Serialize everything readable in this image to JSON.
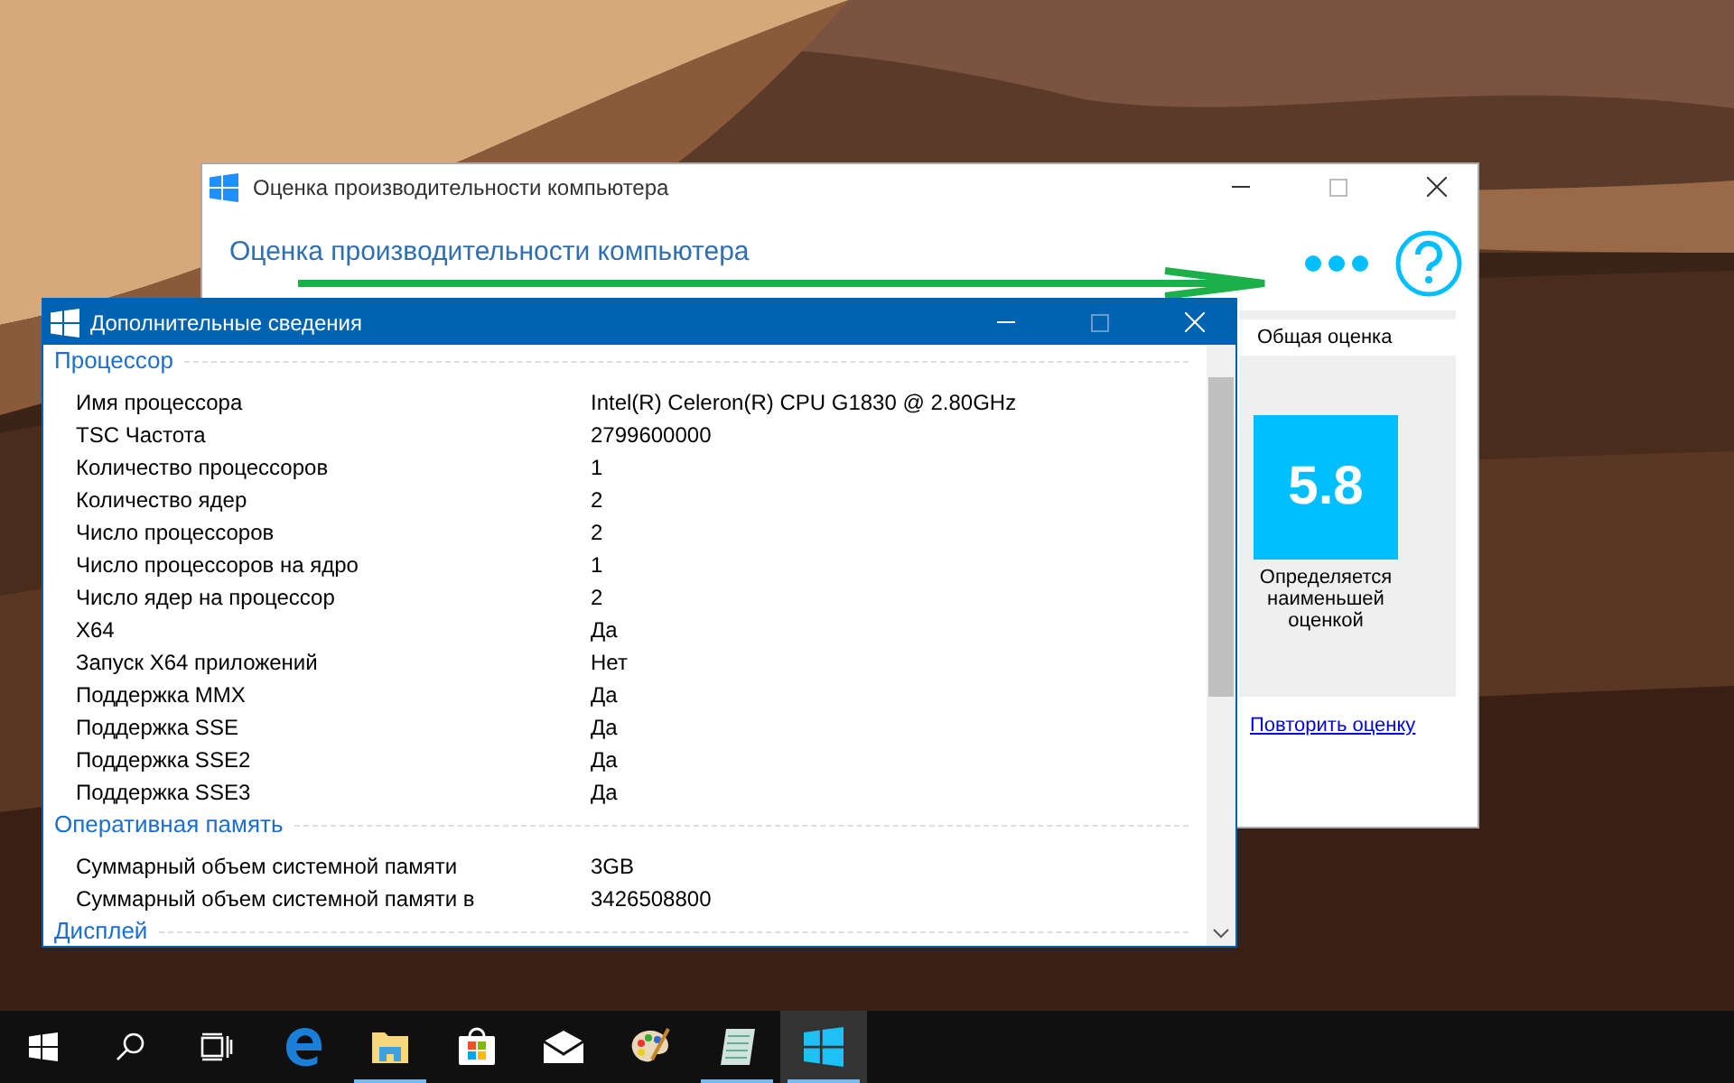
{
  "main_window": {
    "title": "Оценка производительности компьютера",
    "heading": "Оценка производительности компьютера",
    "score_panel": {
      "title": "Общая оценка",
      "score": "5.8",
      "caption": "Определяется наименьшей оценкой",
      "link": "Повторить оценку"
    }
  },
  "details_window": {
    "title": "Дополнительные сведения",
    "sections": [
      {
        "title": "Процессор",
        "rows": [
          {
            "label": "Имя процессора",
            "value": "Intel(R) Celeron(R) CPU G1830 @ 2.80GHz"
          },
          {
            "label": "TSC Частота",
            "value": "2799600000"
          },
          {
            "label": "Количество процессоров",
            "value": "1"
          },
          {
            "label": "Количество ядер",
            "value": "2"
          },
          {
            "label": "Число процессоров",
            "value": "2"
          },
          {
            "label": "Число процессоров на ядро",
            "value": "1"
          },
          {
            "label": "Число ядер на процессор",
            "value": "2"
          },
          {
            "label": "X64",
            "value": "Да"
          },
          {
            "label": "Запуск X64 приложений",
            "value": "Нет"
          },
          {
            "label": "Поддержка MMX",
            "value": "Да"
          },
          {
            "label": "Поддержка SSE",
            "value": "Да"
          },
          {
            "label": "Поддержка SSE2",
            "value": "Да"
          },
          {
            "label": "Поддержка SSE3",
            "value": "Да"
          }
        ]
      },
      {
        "title": "Оперативная память",
        "rows": [
          {
            "label": "Суммарный объем системной памяти",
            "value": "3GB"
          },
          {
            "label": "Суммарный объем системной памяти в",
            "value": "3426508800"
          }
        ]
      },
      {
        "title": "Дисплей"
      }
    ]
  },
  "taskbar": [
    {
      "kind": "start",
      "running": false,
      "selected": false
    },
    {
      "kind": "search",
      "running": false,
      "selected": false
    },
    {
      "kind": "taskview",
      "running": false,
      "selected": false
    },
    {
      "kind": "browser",
      "running": false,
      "selected": false
    },
    {
      "kind": "folder",
      "running": true,
      "selected": false
    },
    {
      "kind": "store",
      "running": false,
      "selected": false
    },
    {
      "kind": "mail",
      "running": false,
      "selected": false
    },
    {
      "kind": "paint",
      "running": false,
      "selected": false
    },
    {
      "kind": "notepad",
      "running": true,
      "selected": false
    },
    {
      "kind": "app",
      "running": true,
      "selected": true
    }
  ]
}
